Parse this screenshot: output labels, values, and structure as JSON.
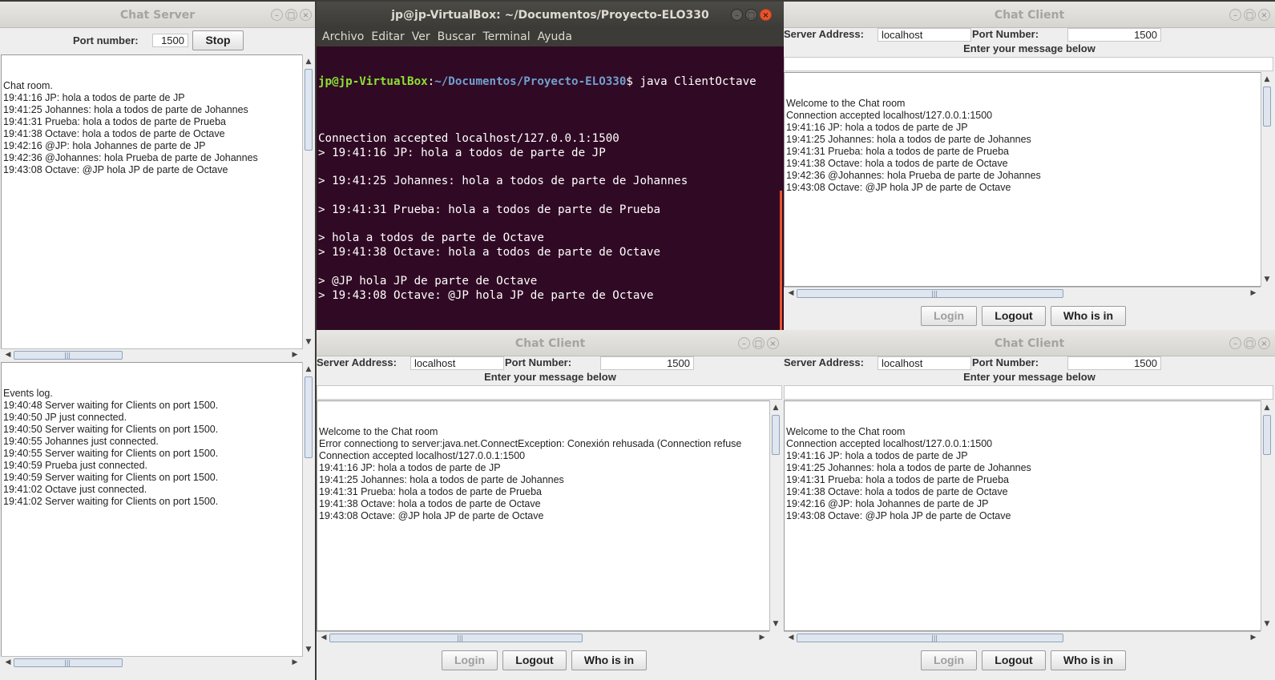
{
  "server": {
    "title": "Chat Server",
    "port_label": "Port number:",
    "port_value": "1500",
    "stop_button": "Stop",
    "chat_lines": [
      "Chat room.",
      "19:41:16 JP: hola a todos de parte de JP",
      "19:41:25 Johannes: hola a todos de parte de Johannes",
      "19:41:31 Prueba: hola a todos de parte de Prueba",
      "19:41:38 Octave: hola a todos de parte de Octave",
      "19:42:16 @JP: hola Johannes de parte de JP",
      "19:42:36 @Johannes: hola Prueba de parte de Johannes",
      "19:43:08 Octave: @JP hola JP de parte de Octave"
    ],
    "event_lines": [
      "Events log.",
      "19:40:48 Server waiting for Clients on port 1500.",
      "19:40:50 JP just connected.",
      "19:40:50 Server waiting for Clients on port 1500.",
      "19:40:55 Johannes just connected.",
      "19:40:55 Server waiting for Clients on port 1500.",
      "19:40:59 Prueba just connected.",
      "19:40:59 Server waiting for Clients on port 1500.",
      "19:41:02 Octave just connected.",
      "19:41:02 Server waiting for Clients on port 1500."
    ]
  },
  "terminal": {
    "title": "jp@jp-VirtualBox: ~/Documentos/Proyecto-ELO330",
    "menu": [
      "Archivo",
      "Editar",
      "Ver",
      "Buscar",
      "Terminal",
      "Ayuda"
    ],
    "prompt_user": "jp@jp-VirtualBox",
    "prompt_path": "~/Documentos/Proyecto-ELO330",
    "prompt_cmd": "$ java ClientOctave",
    "lines": [
      "",
      "Connection accepted localhost/127.0.0.1:1500",
      "> 19:41:16 JP: hola a todos de parte de JP",
      "",
      "> 19:41:25 Johannes: hola a todos de parte de Johannes",
      "",
      "> 19:41:31 Prueba: hola a todos de parte de Prueba",
      "",
      "> hola a todos de parte de Octave",
      "> 19:41:38 Octave: hola a todos de parte de Octave",
      "",
      "> @JP hola JP de parte de Octave",
      "> 19:43:08 Octave: @JP hola JP de parte de Octave",
      ""
    ],
    "last_prompt": "> "
  },
  "client_common": {
    "title": "Chat Client",
    "server_address_label": "Server Address:",
    "server_address_value": "localhost",
    "port_number_label": "Port Number:",
    "port_number_value": "1500",
    "message_label": "Enter your message below",
    "login_button": "Login",
    "logout_button": "Logout",
    "whoisin_button": "Who is in"
  },
  "client_top_right": {
    "lines": [
      "Welcome to the Chat room",
      "Connection accepted localhost/127.0.0.1:1500",
      "19:41:16 JP: hola a todos de parte de JP",
      "19:41:25 Johannes: hola a todos de parte de Johannes",
      "19:41:31 Prueba: hola a todos de parte de Prueba",
      "19:41:38 Octave: hola a todos de parte de Octave",
      "19:42:36 @Johannes: hola Prueba de parte de Johannes",
      "19:43:08 Octave: @JP hola JP de parte de Octave"
    ]
  },
  "client_bottom_mid": {
    "lines": [
      "Welcome to the Chat room",
      "Error connectiong to server:java.net.ConnectException: Conexión rehusada (Connection refuse",
      "Connection accepted localhost/127.0.0.1:1500",
      "19:41:16 JP: hola a todos de parte de JP",
      "19:41:25 Johannes: hola a todos de parte de Johannes",
      "19:41:31 Prueba: hola a todos de parte de Prueba",
      "19:41:38 Octave: hola a todos de parte de Octave",
      "19:43:08 Octave: @JP hola JP de parte de Octave"
    ]
  },
  "client_bottom_right": {
    "lines": [
      "Welcome to the Chat room",
      "Connection accepted localhost/127.0.0.1:1500",
      "19:41:16 JP: hola a todos de parte de JP",
      "19:41:25 Johannes: hola a todos de parte de Johannes",
      "19:41:31 Prueba: hola a todos de parte de Prueba",
      "19:41:38 Octave: hola a todos de parte de Octave",
      "19:42:16 @JP: hola Johannes de parte de JP",
      "19:43:08 Octave: @JP hola JP de parte de Octave"
    ]
  },
  "icons": {
    "minimize": "–",
    "maximize": "□",
    "close": "×",
    "arrow_up": "▲",
    "arrow_down": "▼",
    "arrow_left": "◀",
    "arrow_right": "▶",
    "grip": "|||"
  }
}
